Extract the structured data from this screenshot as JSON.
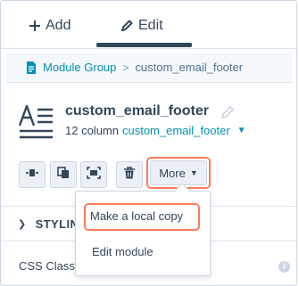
{
  "tabs": {
    "add_label": "Add",
    "edit_label": "Edit"
  },
  "breadcrumb": {
    "parent": "Module Group",
    "separator": ">",
    "current": "custom_email_footer"
  },
  "module": {
    "title": "custom_email_footer",
    "columns_text": "12 column",
    "column_link": "custom_email_footer"
  },
  "toolbar": {
    "more_label": "More"
  },
  "dropdown": {
    "items": [
      "Make a local copy",
      "Edit module"
    ]
  },
  "styling": {
    "section_label": "STYLIN",
    "css_class_label": "CSS Class",
    "info_glyph": "i"
  },
  "colors": {
    "accent_link": "#0091ae",
    "highlight": "#ff7a59",
    "text": "#33475b"
  }
}
